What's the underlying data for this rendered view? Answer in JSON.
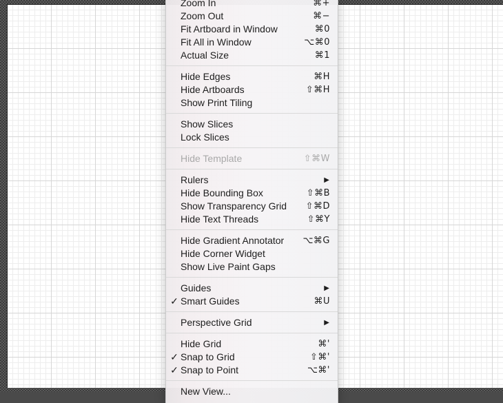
{
  "menu": {
    "groups": [
      {
        "items": [
          {
            "label": "Zoom In",
            "shortcut": "⌘+"
          },
          {
            "label": "Zoom Out",
            "shortcut": "⌘−"
          },
          {
            "label": "Fit Artboard in Window",
            "shortcut": "⌘0"
          },
          {
            "label": "Fit All in Window",
            "shortcut": "⌥⌘0"
          },
          {
            "label": "Actual Size",
            "shortcut": "⌘1"
          }
        ]
      },
      {
        "items": [
          {
            "label": "Hide Edges",
            "shortcut": "⌘H"
          },
          {
            "label": "Hide Artboards",
            "shortcut": "⇧⌘H"
          },
          {
            "label": "Show Print Tiling",
            "shortcut": ""
          }
        ]
      },
      {
        "items": [
          {
            "label": "Show Slices",
            "shortcut": ""
          },
          {
            "label": "Lock Slices",
            "shortcut": ""
          }
        ]
      },
      {
        "items": [
          {
            "label": "Hide Template",
            "shortcut": "⇧⌘W",
            "disabled": true
          }
        ]
      },
      {
        "items": [
          {
            "label": "Rulers",
            "shortcut": "",
            "submenu": true
          },
          {
            "label": "Hide Bounding Box",
            "shortcut": "⇧⌘B"
          },
          {
            "label": "Show Transparency Grid",
            "shortcut": "⇧⌘D"
          },
          {
            "label": "Hide Text Threads",
            "shortcut": "⇧⌘Y"
          }
        ]
      },
      {
        "items": [
          {
            "label": "Hide Gradient Annotator",
            "shortcut": "⌥⌘G"
          },
          {
            "label": "Hide Corner Widget",
            "shortcut": ""
          },
          {
            "label": "Show Live Paint Gaps",
            "shortcut": ""
          }
        ]
      },
      {
        "items": [
          {
            "label": "Guides",
            "shortcut": "",
            "submenu": true
          },
          {
            "label": "Smart Guides",
            "shortcut": "⌘U",
            "checked": true
          }
        ]
      },
      {
        "items": [
          {
            "label": "Perspective Grid",
            "shortcut": "",
            "submenu": true
          }
        ]
      },
      {
        "items": [
          {
            "label": "Hide Grid",
            "shortcut": "⌘'"
          },
          {
            "label": "Snap to Grid",
            "shortcut": "⇧⌘'",
            "checked": true
          },
          {
            "label": "Snap to Point",
            "shortcut": "⌥⌘'",
            "checked": true
          }
        ]
      },
      {
        "items": [
          {
            "label": "New View...",
            "shortcut": ""
          }
        ]
      }
    ],
    "check_glyph": "✓",
    "submenu_glyph": "▶"
  }
}
